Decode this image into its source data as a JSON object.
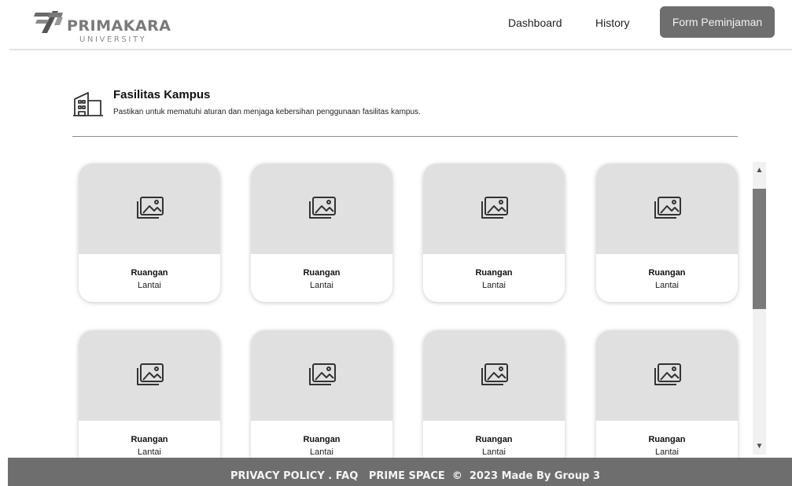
{
  "header": {
    "brand": "PRIMAKARA",
    "brand_sub": "UNIVERSITY",
    "nav": {
      "dashboard": "Dashboard",
      "history": "History",
      "form_button": "Form Peminjaman"
    }
  },
  "section": {
    "icon": "building-icon",
    "title": "Fasilitas Kampus",
    "subtitle": "Pastikan untuk mematuhi aturan dan menjaga kebersihan penggunaan fasilitas kampus."
  },
  "cards": [
    {
      "icon": "image-placeholder-icon",
      "title": "Ruangan",
      "subtitle": "Lantai"
    },
    {
      "icon": "image-placeholder-icon",
      "title": "Ruangan",
      "subtitle": "Lantai"
    },
    {
      "icon": "image-placeholder-icon",
      "title": "Ruangan",
      "subtitle": "Lantai"
    },
    {
      "icon": "image-placeholder-icon",
      "title": "Ruangan",
      "subtitle": "Lantai"
    },
    {
      "icon": "image-placeholder-icon",
      "title": "Ruangan",
      "subtitle": "Lantai"
    },
    {
      "icon": "image-placeholder-icon",
      "title": "Ruangan",
      "subtitle": "Lantai"
    },
    {
      "icon": "image-placeholder-icon",
      "title": "Ruangan",
      "subtitle": "Lantai"
    },
    {
      "icon": "image-placeholder-icon",
      "title": "Ruangan",
      "subtitle": "Lantai"
    }
  ],
  "scrollbar": {
    "up_glyph": "▲",
    "down_glyph": "▼"
  },
  "footer": {
    "privacy": "PRIVACY POLICY",
    "sep": " . ",
    "faq": "FAQ",
    "brand": "PRIME SPACE",
    "copyright": "©",
    "credit": "2023 Made By Group 3"
  },
  "colors": {
    "accent": "#6e6e6e",
    "placeholder": "#e0e0e0",
    "scroll_thumb": "#7a7a7a"
  }
}
